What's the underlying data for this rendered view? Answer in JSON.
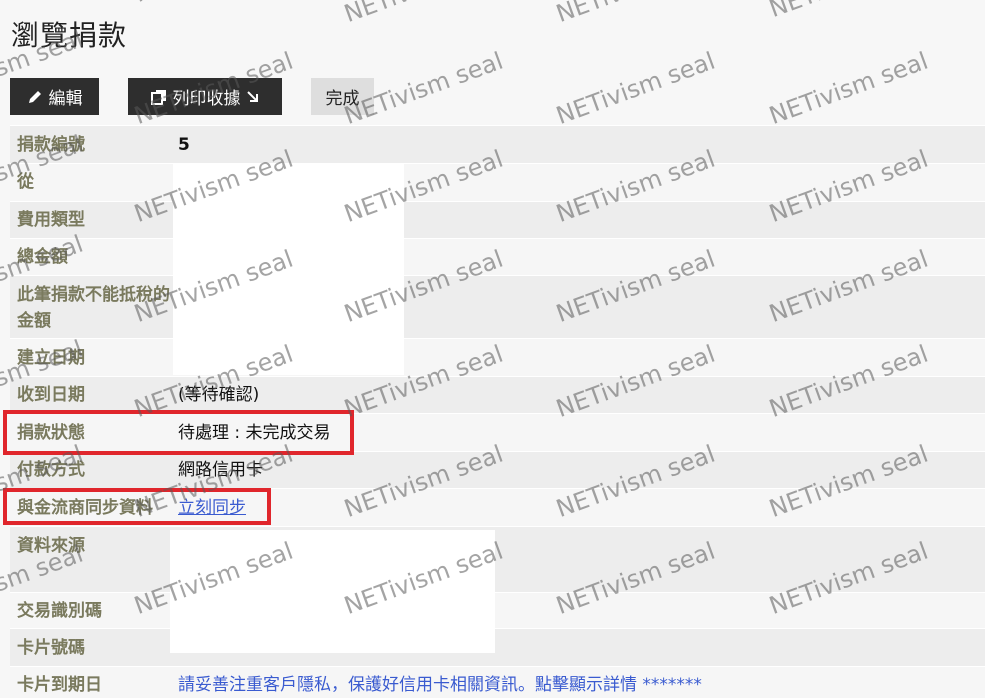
{
  "page": {
    "title": "瀏覽捐款"
  },
  "toolbar": {
    "edit_label": "編輯",
    "print_receipt_label": "列印收據",
    "done_label": "完成"
  },
  "fields": [
    {
      "label": "捐款編號",
      "value": "5"
    },
    {
      "label": "從",
      "value": ""
    },
    {
      "label": "費用類型",
      "value": ""
    },
    {
      "label": "總金額",
      "value": ""
    },
    {
      "label": "此筆捐款不能抵稅的金額",
      "value": ""
    },
    {
      "label": "建立日期",
      "value": ""
    },
    {
      "label": "收到日期",
      "value": "(等待確認)"
    },
    {
      "label": "捐款狀態",
      "value": "待處理 : 未完成交易"
    },
    {
      "label": "付款方式",
      "value": "網路信用卡"
    },
    {
      "label": "與金流商同步資料",
      "value": "立刻同步"
    },
    {
      "label": "資料來源",
      "value": ""
    },
    {
      "label": "交易識別碼",
      "value": ""
    },
    {
      "label": "卡片號碼",
      "value": ""
    },
    {
      "label": "卡片到期日",
      "value": "請妥善注重客戶隱私，保護好信用卡相關資訊。點擊顯示詳情 *******"
    }
  ],
  "watermark": {
    "text": "NETivism seal"
  },
  "colors": {
    "highlight": "#e0262c",
    "link": "#3a5bd0",
    "button_dark": "#2e2e2e",
    "label": "#7a7a5e"
  }
}
